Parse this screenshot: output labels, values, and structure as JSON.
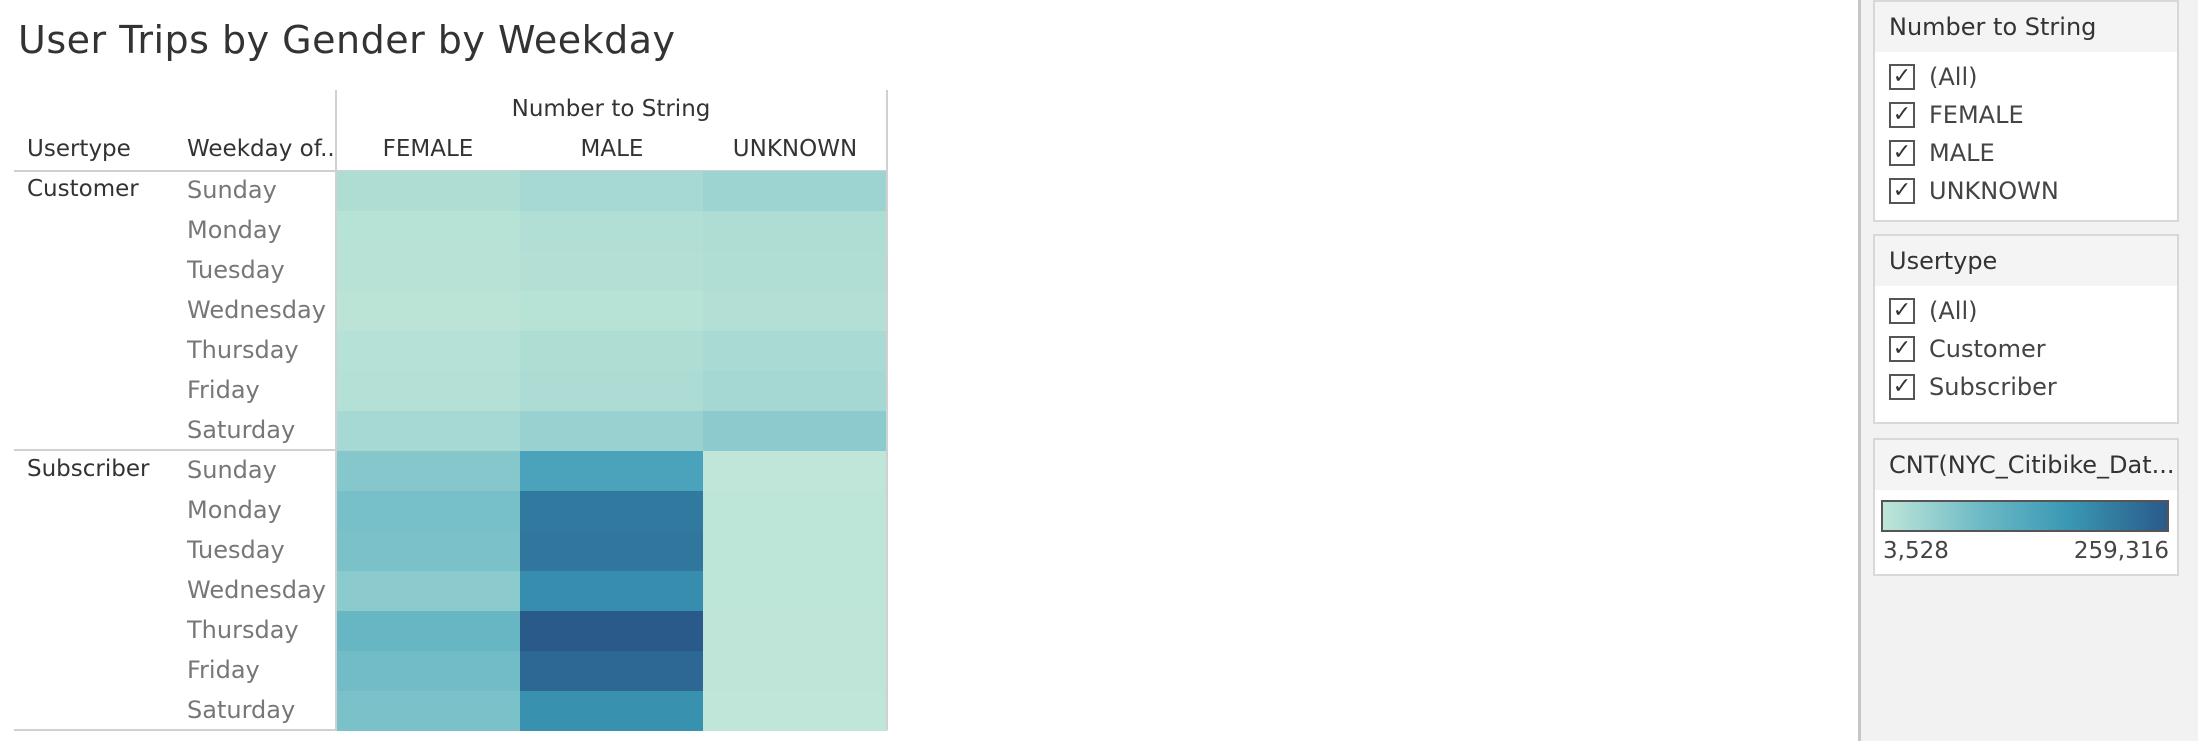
{
  "title": "User Trips by Gender by Weekday",
  "columns_header": "Number to String",
  "row_headers": [
    "Usertype",
    "Weekday of.."
  ],
  "columns": [
    "FEMALE",
    "MALE",
    "UNKNOWN"
  ],
  "groups": [
    "Customer",
    "Subscriber"
  ],
  "days": [
    "Sunday",
    "Monday",
    "Tuesday",
    "Wednesday",
    "Thursday",
    "Friday",
    "Saturday"
  ],
  "filters": {
    "gender": {
      "title": "Number to String",
      "options": [
        "(All)",
        "FEMALE",
        "MALE",
        "UNKNOWN"
      ],
      "checked": [
        true,
        true,
        true,
        true
      ]
    },
    "usertype": {
      "title": "Usertype",
      "options": [
        "(All)",
        "Customer",
        "Subscriber"
      ],
      "checked": [
        true,
        true,
        true
      ]
    }
  },
  "legend": {
    "title": "CNT(NYC_Citibike_Dat...",
    "min_label": "3,528",
    "max_label": "259,316",
    "min": 3528,
    "max": 259316,
    "colors": [
      "#bfe6d8",
      "#6cb9c6",
      "#3a98b4",
      "#2a5a8a"
    ]
  },
  "check_glyph": "✓",
  "chart_data": {
    "type": "heatmap",
    "title": "User Trips by Gender by Weekday",
    "measure": "CNT(NYC_Citibike_Dat...",
    "rows": [
      {
        "usertype": "Customer",
        "weekday": "Sunday",
        "values": [
          22000,
          30000,
          40000
        ]
      },
      {
        "usertype": "Customer",
        "weekday": "Monday",
        "values": [
          12000,
          18000,
          22000
        ]
      },
      {
        "usertype": "Customer",
        "weekday": "Tuesday",
        "values": [
          11000,
          17000,
          20000
        ]
      },
      {
        "usertype": "Customer",
        "weekday": "Wednesday",
        "values": [
          8000,
          12000,
          17000
        ]
      },
      {
        "usertype": "Customer",
        "weekday": "Thursday",
        "values": [
          14000,
          22000,
          27000
        ]
      },
      {
        "usertype": "Customer",
        "weekday": "Friday",
        "values": [
          15000,
          24000,
          32000
        ]
      },
      {
        "usertype": "Customer",
        "weekday": "Saturday",
        "values": [
          30000,
          45000,
          60000
        ]
      },
      {
        "usertype": "Subscriber",
        "weekday": "Sunday",
        "values": [
          65000,
          145000,
          3528
        ]
      },
      {
        "usertype": "Subscriber",
        "weekday": "Monday",
        "values": [
          80000,
          215000,
          4500
        ]
      },
      {
        "usertype": "Subscriber",
        "weekday": "Tuesday",
        "values": [
          78000,
          218000,
          4500
        ]
      },
      {
        "usertype": "Subscriber",
        "weekday": "Wednesday",
        "values": [
          60000,
          185000,
          4200
        ]
      },
      {
        "usertype": "Subscriber",
        "weekday": "Thursday",
        "values": [
          100000,
          259316,
          4800
        ]
      },
      {
        "usertype": "Subscriber",
        "weekday": "Friday",
        "values": [
          88000,
          240000,
          4600
        ]
      },
      {
        "usertype": "Subscriber",
        "weekday": "Saturday",
        "values": [
          78000,
          180000,
          4000
        ]
      }
    ],
    "columns": [
      "FEMALE",
      "MALE",
      "UNKNOWN"
    ],
    "color_range": [
      3528,
      259316
    ]
  }
}
